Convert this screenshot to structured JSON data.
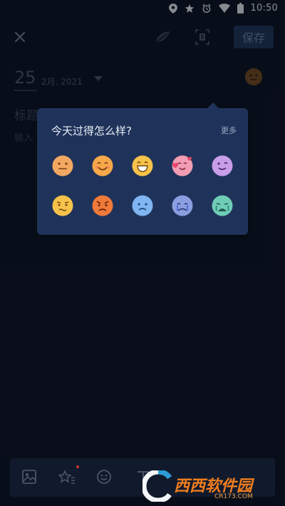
{
  "status_bar": {
    "time": "10:50",
    "icons": [
      "location-icon",
      "star-icon",
      "alarm-icon",
      "wifi-icon",
      "battery-icon"
    ]
  },
  "toolbar": {
    "close_icon": "close-icon",
    "save_label": "保存"
  },
  "entry": {
    "day": "25",
    "month_year": "2月. 2021",
    "title_placeholder": "标题",
    "content_placeholder": "输入"
  },
  "mood_popup": {
    "title": "今天过得怎么样?",
    "more_label": "更多",
    "moods": [
      {
        "name": "neutral",
        "color": "#f3a862"
      },
      {
        "name": "smile",
        "color": "#f7a84a"
      },
      {
        "name": "laugh",
        "color": "#f6c24a"
      },
      {
        "name": "love",
        "color": "#f29db3"
      },
      {
        "name": "wink",
        "color": "#c89ee8"
      },
      {
        "name": "worried",
        "color": "#f6c24a"
      },
      {
        "name": "angry",
        "color": "#ef7a3a"
      },
      {
        "name": "sad",
        "color": "#7fb6f2"
      },
      {
        "name": "crying",
        "color": "#8a9ee0"
      },
      {
        "name": "sobbing",
        "color": "#6fcdb6"
      }
    ]
  },
  "bottom_bar": {
    "icons": [
      "image-icon",
      "stars-icon",
      "emoji-icon",
      "text-format-icon"
    ]
  },
  "watermark": {
    "brand": "西西软件园",
    "url": "CR173.COM"
  },
  "colors": {
    "background": "#0c1322",
    "popup": "#1f335a",
    "accent": "#20355b"
  }
}
